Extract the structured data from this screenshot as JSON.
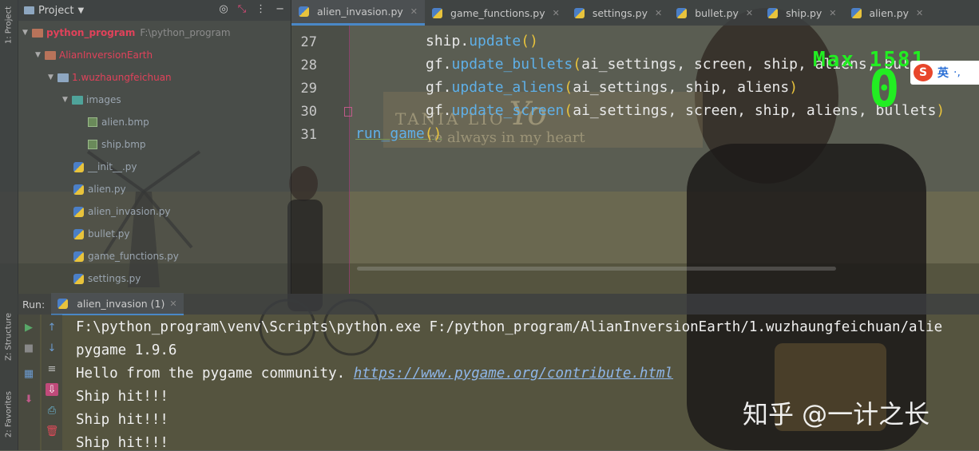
{
  "left_strip": {
    "project_tab": "1: Project",
    "structure_tab": "Z: Structure",
    "favorites_tab": "2: Favorites"
  },
  "project": {
    "header": "Project",
    "tree": [
      {
        "label": "python_program",
        "path": "F:\\python_program"
      },
      {
        "label": "AlianInversionEarth"
      },
      {
        "label": "1.wuzhaungfeichuan"
      },
      {
        "label": "images"
      },
      {
        "label": "alien.bmp"
      },
      {
        "label": "ship.bmp"
      },
      {
        "label": "__init__.py"
      },
      {
        "label": "alien.py"
      },
      {
        "label": "alien_invasion.py"
      },
      {
        "label": "bullet.py"
      },
      {
        "label": "game_functions.py"
      },
      {
        "label": "settings.py"
      }
    ]
  },
  "editor": {
    "tabs": [
      {
        "label": "alien_invasion.py"
      },
      {
        "label": "game_functions.py"
      },
      {
        "label": "settings.py"
      },
      {
        "label": "bullet.py"
      },
      {
        "label": "ship.py"
      },
      {
        "label": "alien.py"
      }
    ],
    "line_numbers": [
      "27",
      "28",
      "29",
      "30",
      "31"
    ],
    "code": {
      "l27_obj": "ship.",
      "l27_fn": "update",
      "l27_args": "",
      "l28_obj": "gf.",
      "l28_fn": "update_bullets",
      "l28_args": "ai_settings, screen, ship, aliens, bul",
      "l29_obj": "gf.",
      "l29_fn": "update_aliens",
      "l29_args": "ai_settings, ship, aliens",
      "l30_obj": "gf.",
      "l30_fn": "update_screen",
      "l30_args": "ai_settings, screen, ship, aliens, bullets",
      "l31_fn": "run_game"
    }
  },
  "game_overlay": {
    "max_label": "Max 1581",
    "score": "0"
  },
  "ime": {
    "logo": "S",
    "lang": "英",
    "punct": "·,"
  },
  "run": {
    "label": "Run:",
    "tab": "alien_invasion (1)",
    "console": [
      "F:\\python_program\\venv\\Scripts\\python.exe F:/python_program/AlianInversionEarth/1.wuzhaungfeichuan/alie",
      "pygame 1.9.6",
      "Hello from the pygame community. ",
      "Ship hit!!!",
      "Ship hit!!!",
      "Ship hit!!!"
    ],
    "link": "https://www.pygame.org/contribute.html"
  },
  "background_text": {
    "name": "TANIA LIO",
    "script": "Yo",
    "tagline": "re always in my heart"
  },
  "watermark": "知乎 @一计之长",
  "colors": {
    "accent": "#4a88c7",
    "error_red": "#e0425a",
    "game_green": "#22ee22",
    "function_blue": "#5fb0e8",
    "paren_yellow": "#e8c33c"
  }
}
